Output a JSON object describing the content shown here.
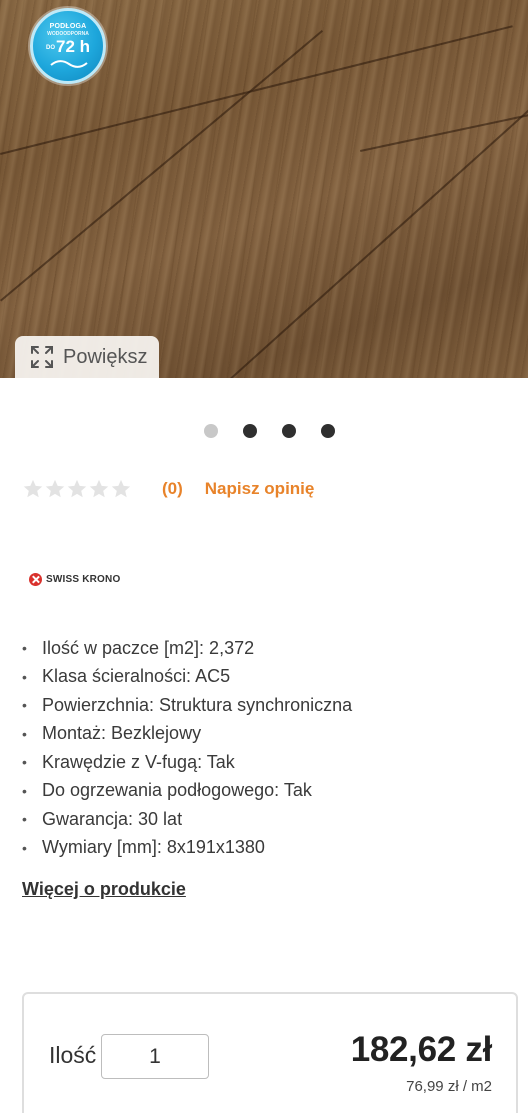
{
  "image_badge": {
    "line1": "PODŁOGA",
    "line2": "WODOODPORNA",
    "prefix": "DO",
    "hours": "72 h"
  },
  "zoom": {
    "label": "Powiększ",
    "icon": "expand-icon"
  },
  "carousel": {
    "count": 4,
    "active_index": 0
  },
  "rating": {
    "stars_filled": 0,
    "stars_total": 5,
    "count_text": "(0)",
    "write_review_label": "Napisz opinię"
  },
  "brand": {
    "name": "SWISS KRONO"
  },
  "specs": [
    "Ilość w paczce [m2]: 2,372",
    "Klasa ścieralności: AC5",
    "Powierzchnia: Struktura synchroniczna",
    "Montaż: Bezklejowy",
    "Krawędzie z V-fugą: Tak",
    "Do ogrzewania podłogowego: Tak",
    "Gwarancja: 30 lat",
    "Wymiary [mm]: 8x191x1380"
  ],
  "more_link": "Więcej o produkcie",
  "purchase": {
    "qty_label": "Ilość",
    "qty_value": "1",
    "price": "182,62 zł",
    "unit_price": "76,99 zł / m2"
  },
  "colors": {
    "accent": "#e8832a",
    "badge_blue": "#1ea7dc",
    "brand_red": "#d9322d"
  }
}
